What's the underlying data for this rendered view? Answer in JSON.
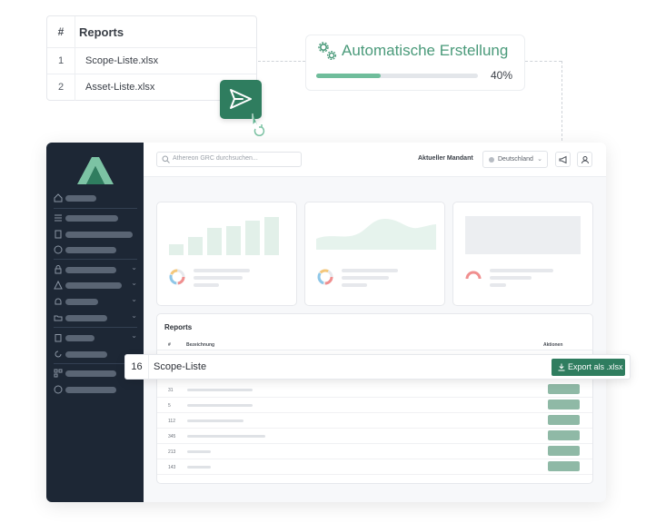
{
  "reports_card": {
    "hash": "#",
    "title": "Reports",
    "rows": [
      {
        "num": "1",
        "name": "Scope-Liste.xlsx"
      },
      {
        "num": "2",
        "name": "Asset-Liste.xlsx"
      }
    ]
  },
  "automation": {
    "title": "Automatische Erstellung",
    "progress_percent": 40,
    "progress_label": "40%",
    "accent": "#4a9a7a"
  },
  "topbar": {
    "search_placeholder": "Athereon GRC durchsuchen...",
    "mandant_label": "Aktueller Mandant",
    "mandant_value": "Deutschland"
  },
  "reports_panel": {
    "title": "Reports",
    "col_hash": "#",
    "col_name": "Bezeichnung",
    "col_actions": "Aktionen",
    "rows": [
      {
        "id": "31"
      },
      {
        "id": "5"
      },
      {
        "id": "112"
      },
      {
        "id": "345"
      },
      {
        "id": "213"
      },
      {
        "id": "143"
      }
    ]
  },
  "highlight_row": {
    "num": "16",
    "name": "Scope-Liste",
    "export_label": "Export als .xlsx"
  },
  "colors": {
    "brand": "#2f7d5f",
    "sidebar": "#1d2735"
  }
}
